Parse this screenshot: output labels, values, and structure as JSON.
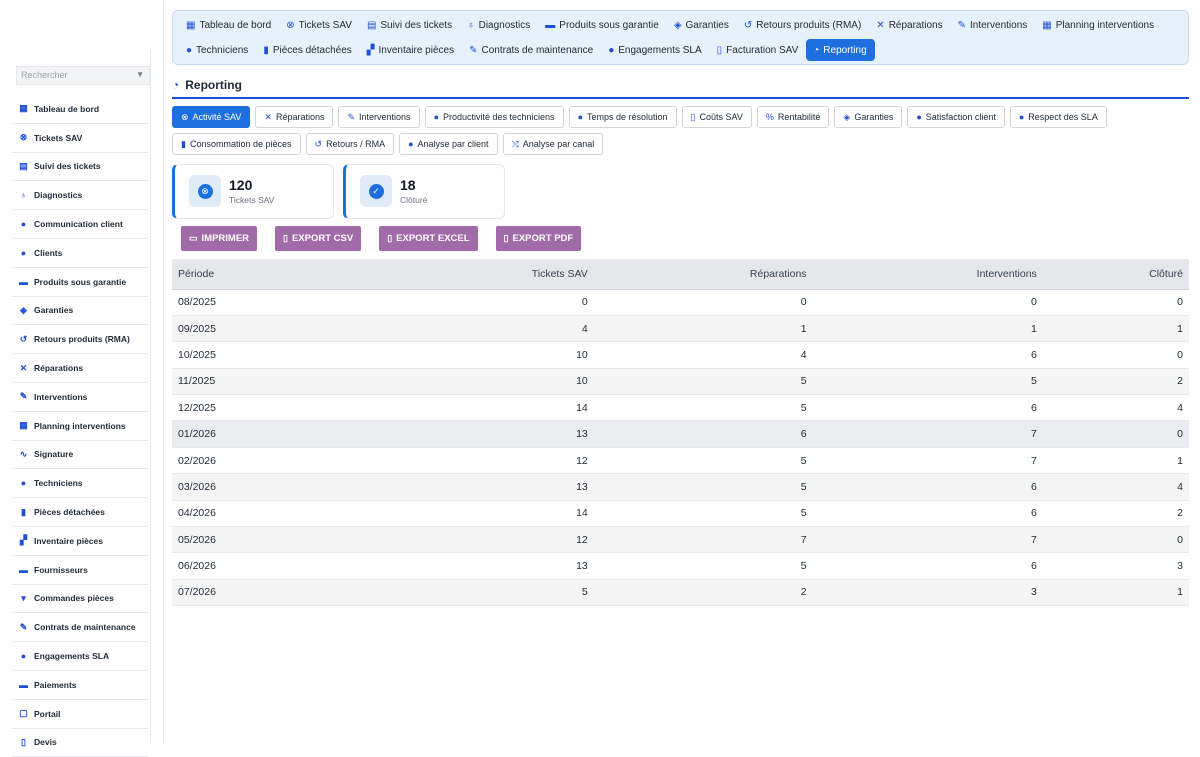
{
  "sidebar": {
    "search_placeholder": "Rechercher",
    "items": [
      {
        "label": "Tableau de bord",
        "icon": "dashboard-icon"
      },
      {
        "label": "Tickets SAV",
        "icon": "lifebuoy-icon"
      },
      {
        "label": "Suivi des tickets",
        "icon": "table-icon"
      },
      {
        "label": "Diagnostics",
        "icon": "stethoscope-icon"
      },
      {
        "label": "Communication client",
        "icon": "chat-icon"
      },
      {
        "label": "Clients",
        "icon": "user-icon"
      },
      {
        "label": "Produits sous garantie",
        "icon": "box-icon"
      },
      {
        "label": "Garanties",
        "icon": "shield-icon"
      },
      {
        "label": "Retours produits (RMA)",
        "icon": "undo-icon"
      },
      {
        "label": "Réparations",
        "icon": "tools-icon"
      },
      {
        "label": "Interventions",
        "icon": "wrench-icon"
      },
      {
        "label": "Planning interventions",
        "icon": "calendar-icon"
      },
      {
        "label": "Signature",
        "icon": "signature-icon"
      },
      {
        "label": "Techniciens",
        "icon": "users-gear-icon"
      },
      {
        "label": "Pièces détachées",
        "icon": "cube-icon"
      },
      {
        "label": "Inventaire pièces",
        "icon": "boxes-icon"
      },
      {
        "label": "Fournisseurs",
        "icon": "truck-icon"
      },
      {
        "label": "Commandes pièces",
        "icon": "cart-icon"
      },
      {
        "label": "Contrats de maintenance",
        "icon": "contract-icon"
      },
      {
        "label": "Engagements SLA",
        "icon": "clock-icon"
      },
      {
        "label": "Paiements",
        "icon": "money-icon"
      },
      {
        "label": "Portail",
        "icon": "portal-icon"
      },
      {
        "label": "Devis",
        "icon": "file-icon"
      }
    ]
  },
  "topnav": {
    "row1": [
      {
        "label": "Tableau de bord",
        "icon": "dashboard-icon"
      },
      {
        "label": "Tickets SAV",
        "icon": "lifebuoy-icon"
      },
      {
        "label": "Suivi des tickets",
        "icon": "table-icon"
      },
      {
        "label": "Diagnostics",
        "icon": "stethoscope-icon"
      },
      {
        "label": "Produits sous garantie",
        "icon": "box-icon"
      },
      {
        "label": "Garanties",
        "icon": "shield-icon"
      },
      {
        "label": "Retours produits (RMA)",
        "icon": "undo-icon"
      },
      {
        "label": "Réparations",
        "icon": "tools-icon"
      },
      {
        "label": "Interventions",
        "icon": "wrench-icon"
      },
      {
        "label": "Planning interventions",
        "icon": "calendar-icon"
      }
    ],
    "row2": [
      {
        "label": "Techniciens",
        "icon": "users-gear-icon"
      },
      {
        "label": "Pièces détachées",
        "icon": "cube-icon"
      },
      {
        "label": "Inventaire pièces",
        "icon": "boxes-icon"
      },
      {
        "label": "Contrats de maintenance",
        "icon": "contract-icon"
      },
      {
        "label": "Engagements SLA",
        "icon": "clock-icon"
      },
      {
        "label": "Facturation SAV",
        "icon": "invoice-icon"
      },
      {
        "label": "Reporting",
        "icon": "pie-chart-icon",
        "active": true
      }
    ]
  },
  "page": {
    "title": "Reporting"
  },
  "subtabs": {
    "row1": [
      {
        "label": "Activité SAV",
        "icon": "lifebuoy-icon",
        "active": true
      },
      {
        "label": "Réparations",
        "icon": "tools-icon"
      },
      {
        "label": "Interventions",
        "icon": "wrench-icon"
      },
      {
        "label": "Productivité des techniciens",
        "icon": "users-gear-icon"
      },
      {
        "label": "Temps de résolution",
        "icon": "stopwatch-icon"
      },
      {
        "label": "Coûts SAV",
        "icon": "file-icon"
      },
      {
        "label": "Rentabilité",
        "icon": "percent-icon"
      },
      {
        "label": "Garanties",
        "icon": "shield-icon"
      },
      {
        "label": "Satisfaction client",
        "icon": "smile-icon"
      },
      {
        "label": "Respect des SLA",
        "icon": "clock-icon"
      }
    ],
    "row2": [
      {
        "label": "Consommation de pièces",
        "icon": "cube-icon"
      },
      {
        "label": "Retours / RMA",
        "icon": "undo-icon"
      },
      {
        "label": "Analyse par client",
        "icon": "user-icon"
      },
      {
        "label": "Analyse par canal",
        "icon": "shuffle-icon"
      }
    ]
  },
  "cards": [
    {
      "value": "120",
      "label": "Tickets SAV",
      "icon": "lifebuoy-icon"
    },
    {
      "value": "18",
      "label": "Clôturé",
      "icon": "check-icon"
    }
  ],
  "exports": [
    {
      "label": "IMPRIMER",
      "icon": "print-icon"
    },
    {
      "label": "EXPORT CSV",
      "icon": "file-icon"
    },
    {
      "label": "EXPORT EXCEL",
      "icon": "file-icon"
    },
    {
      "label": "EXPORT PDF",
      "icon": "file-icon"
    }
  ],
  "table": {
    "columns": [
      "Période",
      "Tickets SAV",
      "Réparations",
      "Interventions",
      "Clôturé"
    ],
    "rows": [
      [
        "08/2025",
        "0",
        "0",
        "0",
        "0"
      ],
      [
        "09/2025",
        "4",
        "1",
        "1",
        "1"
      ],
      [
        "10/2025",
        "10",
        "4",
        "6",
        "0"
      ],
      [
        "11/2025",
        "10",
        "5",
        "5",
        "2"
      ],
      [
        "12/2025",
        "14",
        "5",
        "6",
        "4"
      ],
      [
        "01/2026",
        "13",
        "6",
        "7",
        "0"
      ],
      [
        "02/2026",
        "12",
        "5",
        "7",
        "1"
      ],
      [
        "03/2026",
        "13",
        "5",
        "6",
        "4"
      ],
      [
        "04/2026",
        "14",
        "5",
        "6",
        "2"
      ],
      [
        "05/2026",
        "12",
        "7",
        "7",
        "0"
      ],
      [
        "06/2026",
        "13",
        "5",
        "6",
        "3"
      ],
      [
        "07/2026",
        "5",
        "2",
        "3",
        "1"
      ]
    ]
  }
}
